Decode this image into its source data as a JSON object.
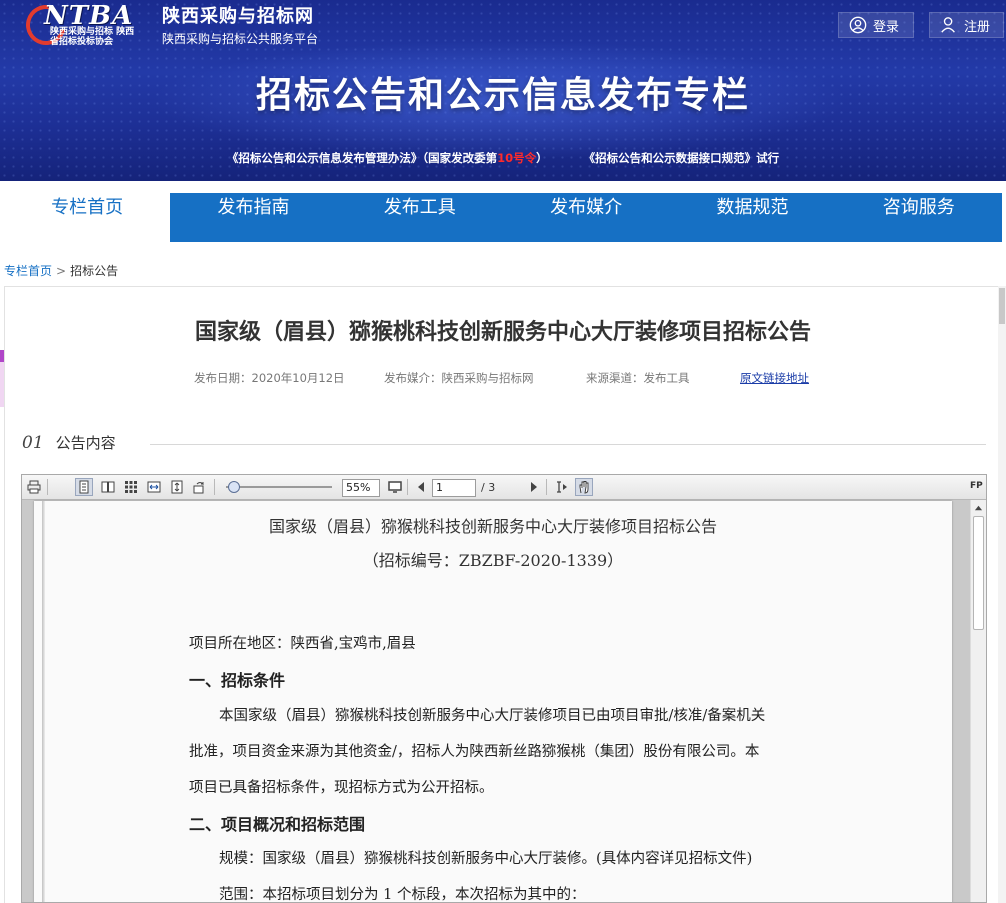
{
  "header": {
    "logo_brand": "NTBA",
    "logo_sub": "陕西采购与招标 陕西省招标投标协会",
    "site_name": "陕西采购与招标网",
    "site_subtitle": "陕西采购与招标公共服务平台",
    "login_label": "登录",
    "register_label": "注册",
    "banner_title": "招标公告和公示信息发布专栏",
    "link1_prefix": "《招标公告和公示信息发布管理办法》（国家发改委第",
    "link1_num": "10号令",
    "link1_suffix": "）",
    "link2": "《招标公告和公示数据接口规范》试行",
    "accent_red": "#ff2a2a"
  },
  "nav": {
    "items": [
      "专栏首页",
      "发布指南",
      "发布工具",
      "发布媒介",
      "数据规范",
      "咨询服务"
    ],
    "active_index": 0,
    "color": "#1670c4"
  },
  "breadcrumb": {
    "home": "专栏首页",
    "separator": ">",
    "current": "招标公告"
  },
  "article": {
    "title": "国家级（眉县）猕猴桃科技创新服务中心大厅装修项目招标公告",
    "date": "发布日期：2020年10月12日",
    "media": "发布媒介：陕西采购与招标网",
    "source": "来源渠道：发布工具",
    "link": "原文链接地址",
    "section_num": "01",
    "section_label": "公告内容"
  },
  "viewer": {
    "zoom": "55%",
    "page": "1",
    "total": "/ 3",
    "fp": "FP"
  },
  "document": {
    "title": "国家级（眉县）猕猴桃科技创新服务中心大厅装修项目招标公告",
    "code": "（招标编号：ZBZBF-2020-1339）",
    "location": "项目所在地区：陕西省,宝鸡市,眉县",
    "heading1": "一、招标条件",
    "para1_line1": "本国家级（眉县）猕猴桃科技创新服务中心大厅装修项目已由项目审批/核准/备案机关",
    "para1_line2": "批准，项目资金来源为其他资金/，招标人为陕西新丝路猕猴桃（集团）股份有限公司。本",
    "para1_line3": "项目已具备招标条件，现招标方式为公开招标。",
    "heading2": "二、项目概况和招标范围",
    "scale": "规模：国家级（眉县）猕猴桃科技创新服务中心大厅装修。(具体内容详见招标文件)",
    "scope": "范围：本招标项目划分为 1 个标段，本次招标为其中的："
  }
}
